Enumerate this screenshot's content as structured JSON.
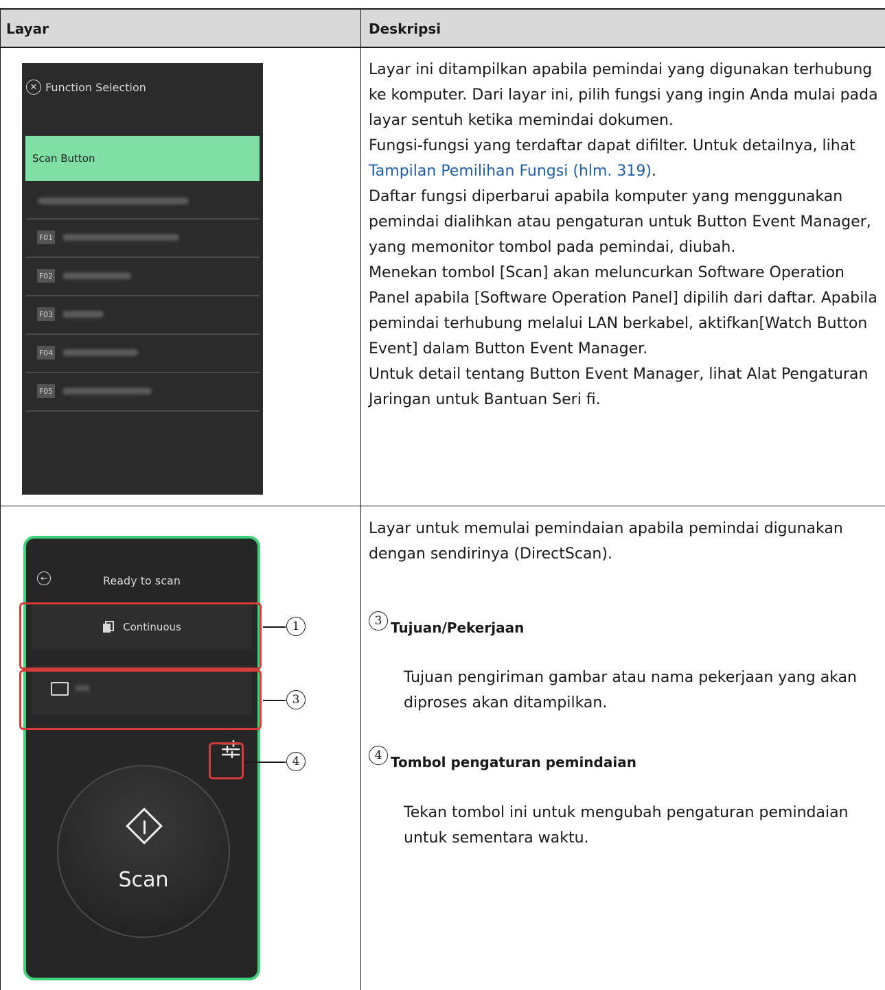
{
  "table": {
    "header_screen": "Layar",
    "header_desc": "Deskripsi"
  },
  "row1": {
    "screen": {
      "title": "Function Selection",
      "close_icon": "close-circle-icon",
      "selected": "Scan Button",
      "items": [
        {
          "code": "F01"
        },
        {
          "code": "F02"
        },
        {
          "code": "F03"
        },
        {
          "code": "F04"
        },
        {
          "code": "F05"
        }
      ]
    },
    "desc": {
      "p1": "Layar ini ditampilkan apabila pemindai yang digunakan terhubung ke komputer. Dari layar ini, pilih fungsi yang ingin Anda mulai pada layar sentuh ketika memindai dokumen.",
      "p2_pre": "Fungsi-fungsi yang terdaftar dapat difilter. Untuk detailnya, lihat ",
      "p2_link": "Tampilan Pemilihan Fungsi (hlm. 319)",
      "p2_post": ".",
      "p3": "Daftar fungsi diperbarui apabila komputer yang menggunakan pemindai dialihkan atau pengaturan untuk Button Event Manager, yang memonitor tombol pada pemindai, diubah.",
      "p4": "Menekan tombol [Scan] akan meluncurkan Software Operation Panel apabila [Software Operation Panel] dipilih dari daftar. Apabila pemindai terhubung melalui LAN berkabel, aktifkan[Watch Button Event] dalam Button Event Manager.",
      "p5": "Untuk detail tentang Button Event Manager, lihat Alat Pengaturan Jaringan untuk Bantuan Seri fi.",
      "link_color": "#1f5fa8"
    }
  },
  "row2": {
    "screen": {
      "title": "Ready to scan",
      "continuous": "Continuous",
      "scan_label": "Scan",
      "callouts": [
        "1",
        "3",
        "4"
      ],
      "border_color": "#3fd27a",
      "highlight_color": "#d83a3a"
    },
    "desc": {
      "intro": "Layar untuk memulai pemindaian apabila pemindai digunakan dengan sendirinya (DirectScan).",
      "item3_num": "3",
      "item3_title": "Tujuan/Pekerjaan",
      "item3_text": "Tujuan pengiriman gambar atau nama pekerjaan yang akan diproses akan ditampilkan.",
      "item4_num": "4",
      "item4_title": "Tombol pengaturan pemindaian",
      "item4_text": "Tekan tombol ini untuk mengubah pengaturan pemindaian untuk sementara waktu."
    }
  }
}
